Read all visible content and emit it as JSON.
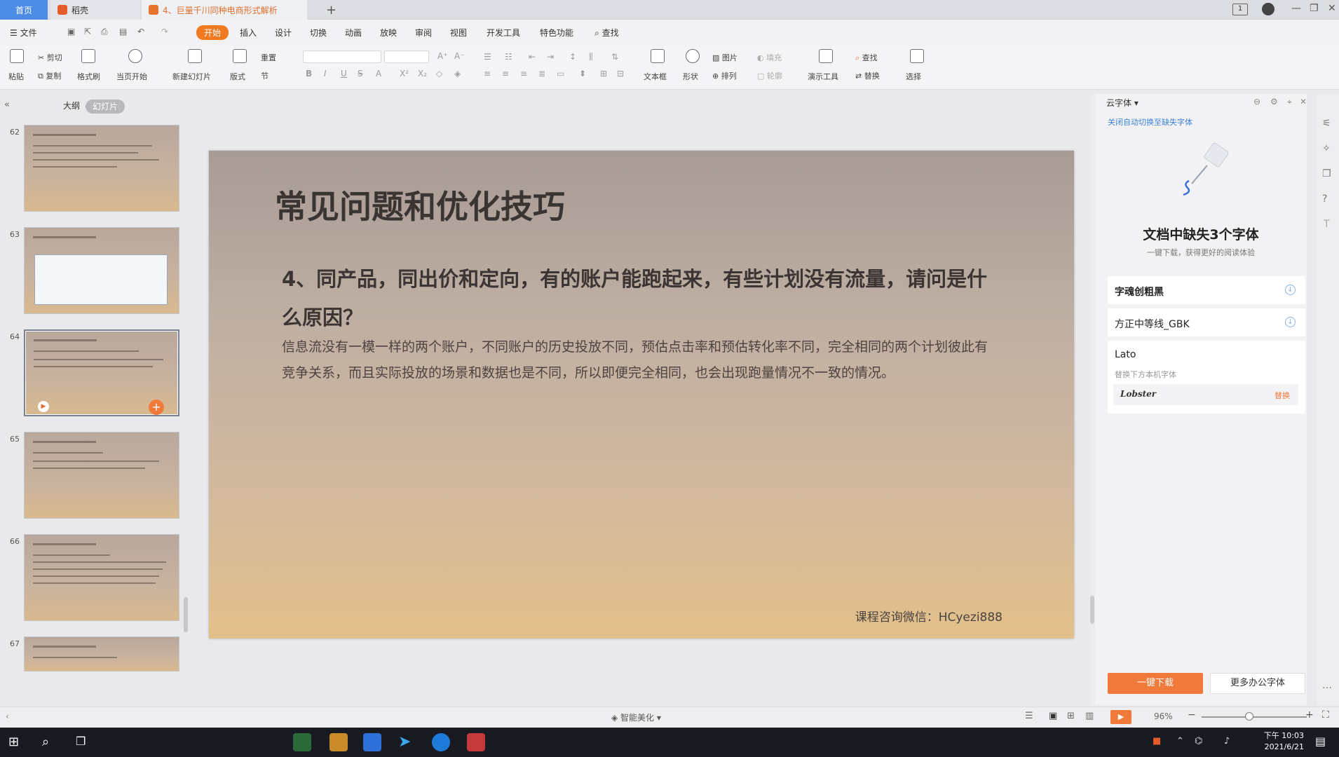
{
  "titlebar": {
    "tabs": [
      {
        "label": "首页"
      },
      {
        "label": "稻壳"
      },
      {
        "label": "4、巨量千川同种电商形式解析"
      }
    ],
    "new_tab": "+",
    "badge": "1"
  },
  "menu": {
    "file": "文件",
    "items": [
      "开始",
      "插入",
      "设计",
      "切换",
      "动画",
      "放映",
      "审阅",
      "视图",
      "开发工具",
      "特色功能"
    ],
    "search": "查找"
  },
  "ribbon": {
    "paste": "粘贴",
    "cut": "剪切",
    "copy": "复制",
    "format_painter": "格式刷",
    "from_current": "当页开始",
    "new_slide": "新建幻灯片",
    "layout": "版式",
    "reset": "重置",
    "section": "节",
    "textbox": "文本框",
    "shapes": "形状",
    "picture": "图片",
    "fill": "填充",
    "arrange": "排列",
    "outline": "轮廓",
    "present_tools": "演示工具",
    "find": "查找",
    "replace": "替换",
    "select": "选择"
  },
  "leftpane": {
    "tab_outline": "大纲",
    "tab_slides": "幻灯片",
    "thumbs": [
      "62",
      "63",
      "64",
      "65",
      "66",
      "67"
    ]
  },
  "slide": {
    "title": "常见问题和优化技巧",
    "question": "4、同产品，同出价和定向，有的账户能跑起来，有些计划没有流量，请问是什么原因？",
    "body": "信息流没有一模一样的两个账户，不同账户的历史投放不同，预估点击率和预估转化率不同，完全相同的两个计划彼此有竞争关系，而且实际投放的场景和数据也是不同，所以即便完全相同，也会出现跑量情况不一致的情况。",
    "footer": "课程咨询微信：HCyezi888"
  },
  "fontpanel": {
    "header": "云字体",
    "link": "关闭自动切换至缺失字体",
    "title": "文档中缺失3个字体",
    "subtitle": "一键下载，获得更好的阅读体验",
    "fonts": [
      {
        "name": "字魂创粗黑"
      },
      {
        "name": "方正中等线_GBK"
      },
      {
        "name": "Lato",
        "note": "替换下方本机字体",
        "replacement": "Lobster",
        "action": "替换"
      }
    ],
    "download_all": "一键下载",
    "more_fonts": "更多办公字体"
  },
  "statusbar": {
    "beautify": "智能美化",
    "zoom": "96%"
  },
  "taskbar": {
    "time": "下午 10:03",
    "date": "2021/6/21"
  }
}
